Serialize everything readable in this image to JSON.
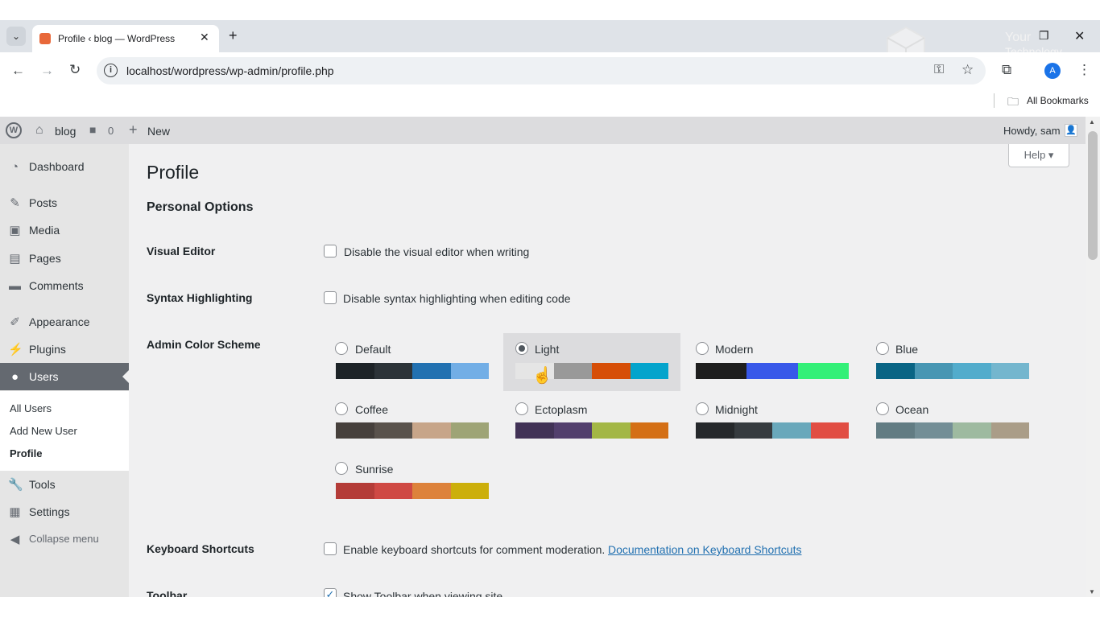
{
  "browser": {
    "tab_title": "Profile ‹ blog — WordPress",
    "url": "localhost/wordpress/wp-admin/profile.php",
    "bookmarks_label": "All Bookmarks",
    "profile_initial": "A",
    "watermark_text_1": "Your",
    "watermark_text_2": "Technology"
  },
  "adminbar": {
    "site_name": "blog",
    "comments_count": "0",
    "new_label": "New",
    "howdy": "Howdy, sam"
  },
  "sidebar": {
    "items": [
      {
        "label": "Dashboard",
        "icon": "dashboard-icon"
      },
      {
        "label": "Posts",
        "icon": "pin-icon"
      },
      {
        "label": "Media",
        "icon": "media-icon"
      },
      {
        "label": "Pages",
        "icon": "pages-icon"
      },
      {
        "label": "Comments",
        "icon": "comment-icon"
      },
      {
        "label": "Appearance",
        "icon": "brush-icon"
      },
      {
        "label": "Plugins",
        "icon": "plug-icon"
      },
      {
        "label": "Users",
        "icon": "users-icon"
      },
      {
        "label": "Tools",
        "icon": "wrench-icon"
      },
      {
        "label": "Settings",
        "icon": "settings-icon"
      },
      {
        "label": "Collapse menu",
        "icon": "collapse-icon"
      }
    ],
    "submenu": [
      "All Users",
      "Add New User",
      "Profile"
    ]
  },
  "main": {
    "title": "Profile",
    "help_label": "Help ▾",
    "section_title": "Personal Options",
    "visual_editor": {
      "label": "Visual Editor",
      "text": "Disable the visual editor when writing",
      "checked": false
    },
    "syntax": {
      "label": "Syntax Highlighting",
      "text": "Disable syntax highlighting when editing code",
      "checked": false
    },
    "color_scheme_label": "Admin Color Scheme",
    "schemes": [
      {
        "name": "Default",
        "colors": [
          "#1d2327",
          "#2c3338",
          "#2271b1",
          "#72aee6"
        ],
        "selected": false
      },
      {
        "name": "Light",
        "colors": [
          "#e5e5e5",
          "#999999",
          "#d64e07",
          "#04a4cc"
        ],
        "selected": true
      },
      {
        "name": "Modern",
        "colors": [
          "#1e1e1e",
          "#3858e9",
          "#33f078"
        ],
        "selected": false
      },
      {
        "name": "Blue",
        "colors": [
          "#096484",
          "#4796b3",
          "#52accc",
          "#74b6ce"
        ],
        "selected": false
      },
      {
        "name": "Coffee",
        "colors": [
          "#46403c",
          "#59524c",
          "#c7a589",
          "#9ea476"
        ],
        "selected": false
      },
      {
        "name": "Ectoplasm",
        "colors": [
          "#413256",
          "#523f6d",
          "#a3b745",
          "#d46f15"
        ],
        "selected": false
      },
      {
        "name": "Midnight",
        "colors": [
          "#25282b",
          "#363b3f",
          "#69a8bb",
          "#e14d43"
        ],
        "selected": false
      },
      {
        "name": "Ocean",
        "colors": [
          "#627c83",
          "#738e96",
          "#9ebaa0",
          "#aa9d88"
        ],
        "selected": false
      },
      {
        "name": "Sunrise",
        "colors": [
          "#b43c38",
          "#cf4944",
          "#dd823b",
          "#ccaf0b"
        ],
        "selected": false
      }
    ],
    "keyboard": {
      "label": "Keyboard Shortcuts",
      "text": "Enable keyboard shortcuts for comment moderation.",
      "link": "Documentation on Keyboard Shortcuts",
      "checked": false
    },
    "toolbar": {
      "label": "Toolbar",
      "text": "Show Toolbar when viewing site",
      "checked": true
    }
  }
}
